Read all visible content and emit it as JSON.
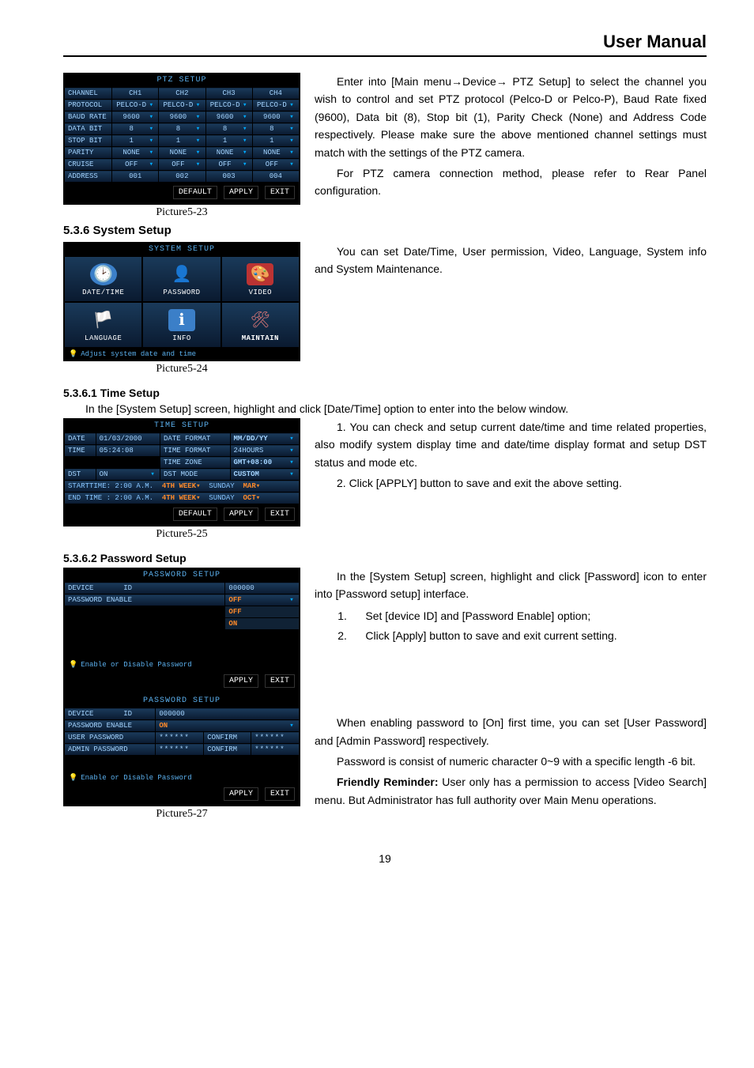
{
  "header": {
    "title": "User Manual"
  },
  "ptz": {
    "title": "PTZ SETUP",
    "rows": {
      "channel": {
        "label": "CHANNEL",
        "v1": "CH1",
        "v2": "CH2",
        "v3": "CH3",
        "v4": "CH4"
      },
      "protocol": {
        "label": "PROTOCOL",
        "v1": "PELCO-D",
        "v2": "PELCO-D",
        "v3": "PELCO-D",
        "v4": "PELCO-D"
      },
      "baud": {
        "label": "BAUD RATE",
        "v1": "9600",
        "v2": "9600",
        "v3": "9600",
        "v4": "9600"
      },
      "databit": {
        "label": "DATA BIT",
        "v1": "8",
        "v2": "8",
        "v3": "8",
        "v4": "8"
      },
      "stopbit": {
        "label": "STOP BIT",
        "v1": "1",
        "v2": "1",
        "v3": "1",
        "v4": "1"
      },
      "parity": {
        "label": "PARITY",
        "v1": "NONE",
        "v2": "NONE",
        "v3": "NONE",
        "v4": "NONE"
      },
      "cruise": {
        "label": "CRUISE",
        "v1": "OFF",
        "v2": "OFF",
        "v3": "OFF",
        "v4": "OFF"
      },
      "address": {
        "label": "ADDRESS",
        "v1": "001",
        "v2": "002",
        "v3": "003",
        "v4": "004"
      }
    },
    "buttons": {
      "default": "DEFAULT",
      "apply": "APPLY",
      "exit": "EXIT"
    },
    "caption": "Picture5-23"
  },
  "ptz_text": {
    "p1": "Enter into [Main menu→Device→ PTZ Setup] to select the channel you wish to control and set PTZ protocol (Pelco-D or Pelco-P), Baud Rate fixed (9600), Data bit (8), Stop bit (1), Parity Check (None) and Address Code respectively. Please make sure the above mentioned channel settings must match with the settings of the PTZ camera.",
    "p2": "For PTZ camera connection method, please refer to Rear Panel configuration."
  },
  "system_setup": {
    "heading": "5.3.6 System Setup",
    "title": "SYSTEM SETUP",
    "icons": {
      "datetime": "DATE/TIME",
      "password": "PASSWORD",
      "video": "VIDEO",
      "language": "LANGUAGE",
      "info": "INFO",
      "maintain": "MAINTAIN"
    },
    "tip": "Adjust system date and time",
    "caption": "Picture5-24",
    "text": "You can set Date/Time, User permission, Video, Language, System info and System Maintenance."
  },
  "time_setup": {
    "heading": "5.3.6.1 Time Setup",
    "intro": "In the [System Setup] screen, highlight and click [Date/Time] option to enter into the below window.",
    "panel": {
      "title": "TIME SETUP",
      "date_lbl": "DATE",
      "date_val": "01/03/2000",
      "datefmt_lbl": "DATE FORMAT",
      "datefmt_val": "MM/DD/YY",
      "time_lbl": "TIME",
      "time_val": "05:24:08",
      "timefmt_lbl": "TIME FORMAT",
      "timefmt_val": "24HOURS",
      "tz_lbl": "TIME ZONE",
      "tz_val": "GMT+08:00",
      "dst_lbl": "DST",
      "dst_val": "ON",
      "dstmode_lbl": "DST MODE",
      "dstmode_val": "CUSTOM",
      "start_lbl": "STARTTIME:",
      "start_time": "2:00 A.M.",
      "start_week": "4TH WEEK",
      "start_day": "SUNDAY",
      "start_mon": "MAR",
      "end_lbl": "END TIME :",
      "end_time": "2:00 A.M.",
      "end_week": "4TH WEEK",
      "end_day": "SUNDAY",
      "end_mon": "OCT",
      "default": "DEFAULT",
      "apply": "APPLY",
      "exit": "EXIT"
    },
    "caption": "Picture5-25",
    "p1": "1. You can check and setup current date/time and time related properties, also modify system display time and date/time display format and setup DST status and mode etc.",
    "p2": "2. Click [APPLY] button to save and exit the above setting."
  },
  "password_setup": {
    "heading": "5.3.6.2 Password Setup",
    "panel1": {
      "title": "PASSWORD SETUP",
      "devid_lbl": "DEVICE       ID",
      "devid_val": "000000",
      "pwen_lbl": "PASSWORD ENABLE",
      "pwen_val": "OFF",
      "opt_off": "OFF",
      "opt_on": "ON",
      "tip": "Enable or Disable Password",
      "apply": "APPLY",
      "exit": "EXIT"
    },
    "panel2": {
      "title": "PASSWORD SETUP",
      "devid_lbl": "DEVICE       ID",
      "devid_val": "000000",
      "pwen_lbl": "PASSWORD ENABLE",
      "pwen_val": "ON",
      "user_lbl": "USER PASSWORD",
      "user_val": "******",
      "user_conf_lbl": "CONFIRM",
      "user_conf_val": "******",
      "admin_lbl": "ADMIN PASSWORD",
      "admin_val": "******",
      "admin_conf_lbl": "CONFIRM",
      "admin_conf_val": "******",
      "tip": "Enable or Disable Password",
      "apply": "APPLY",
      "exit": "EXIT"
    },
    "caption": "Picture5-27",
    "intro": "In the [System Setup] screen, highlight and click [Password] icon to enter into [Password setup] interface.",
    "step1": "Set   [device ID] and [Password Enable] option;",
    "step2": "Click [Apply] button to save and exit current setting.",
    "p3": "When enabling password to [On] first time, you can set [User Password] and [Admin Password] respectively.",
    "p4": "Password is consist of numeric character 0~9 with a specific length -6 bit.",
    "p5a": "Friendly Reminder:",
    "p5b": " User only has a permission to access [Video Search] menu. But Administrator has full authority over Main Menu operations."
  },
  "page_number": "19"
}
